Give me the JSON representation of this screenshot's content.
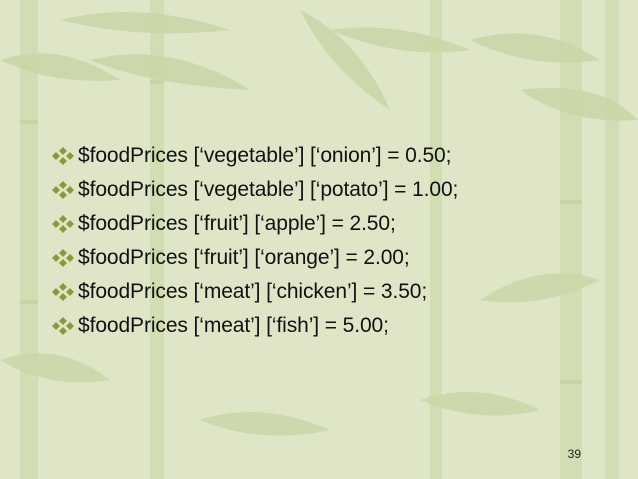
{
  "slide": {
    "lines": [
      "$foodPrices [‘vegetable’] [‘onion’] = 0.50;",
      "$foodPrices [‘vegetable’] [‘potato’] = 1.00;",
      "$foodPrices [‘fruit’] [‘apple’] = 2.50;",
      "$foodPrices [‘fruit’] [‘orange’] = 2.00;",
      "$foodPrices [‘meat’] [‘chicken’] = 3.50;",
      "$foodPrices [‘meat’] [‘fish’] = 5.00;"
    ],
    "page_number": "39"
  },
  "colors": {
    "background": "#dfe6c8",
    "bamboo": "#cfd9ae",
    "bullet": "#8a9a3a",
    "text": "#111111"
  },
  "icons": {
    "bullet": "diamond-cluster-icon"
  }
}
